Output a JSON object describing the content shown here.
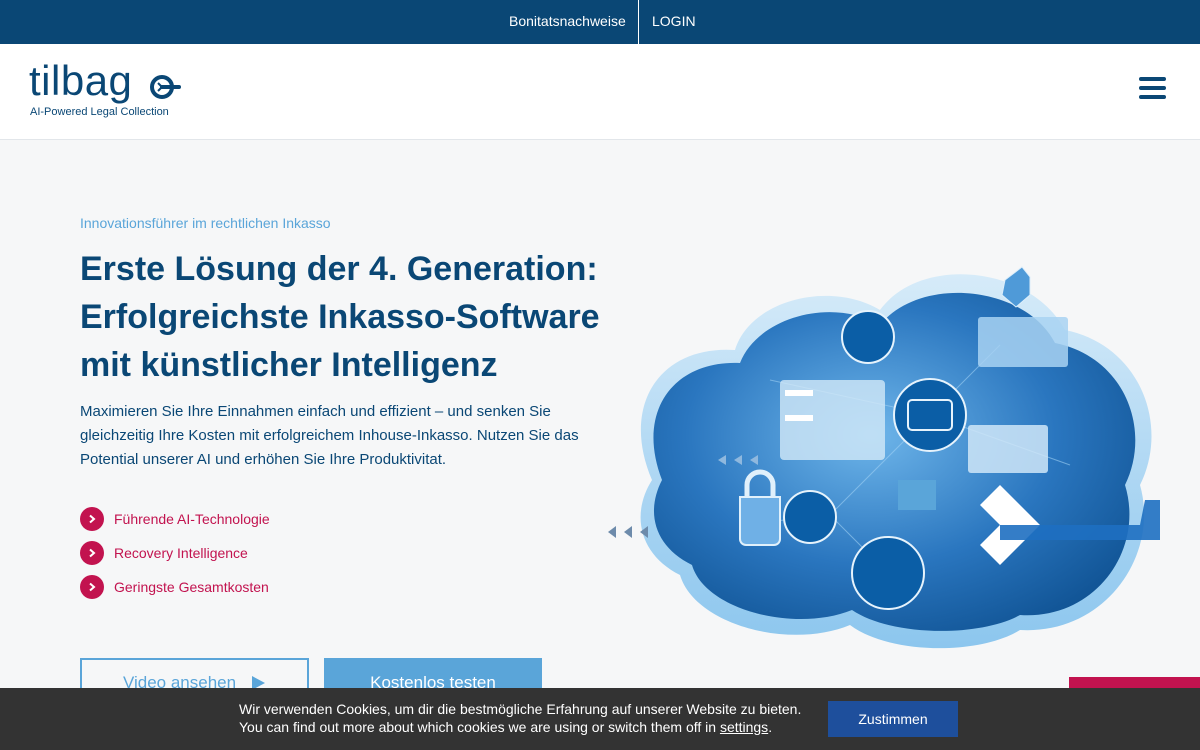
{
  "topnav": {
    "credit_reports": "Bonitatsnachweise",
    "login": "LOGIN"
  },
  "brand": {
    "name": "tilbag",
    "tagline": "AI-Powered Legal Collection"
  },
  "hero": {
    "kicker": "Innovationsführer im rechtlichen Inkasso",
    "headline_lines": [
      "Erste Lösung der 4. Generation:",
      "Erfolgreichste Inkasso-Software",
      "mit künstlicher Intelligenz"
    ],
    "lead": "Maximieren Sie Ihre Einnahmen einfach und effizient – und senken Sie gleichzeitig Ihre Kosten mit erfolgreichem Inhouse-Inkasso. Nutzen Sie das Potential unserer AI und erhöhen Sie Ihre Produktivitat.",
    "features": [
      "Führende AI-Technologie",
      "Recovery Intelligence",
      "Geringste Gesamtkosten"
    ],
    "video_button": "Video ansehen",
    "trial_button": "Kostenlos testen"
  },
  "cookie": {
    "line1": "Wir verwenden Cookies, um dir die bestmögliche Erfahrung auf unserer Website zu bieten.",
    "line2_prefix": "You can find out more about which cookies we are using or switch them off in",
    "settings_link": "settings",
    "line2_suffix": ".",
    "accept_button": "Zustimmen"
  },
  "colors": {
    "brand_navy": "#0a4775",
    "accent_light_blue": "#5aa5d9",
    "accent_magenta": "#c2134f",
    "cookie_bg": "#333333",
    "cookie_button": "#1e4f9c"
  },
  "icons": [
    "hamburger-menu-icon",
    "chevron-right-icon",
    "play-icon",
    "logo-mark-icon"
  ]
}
